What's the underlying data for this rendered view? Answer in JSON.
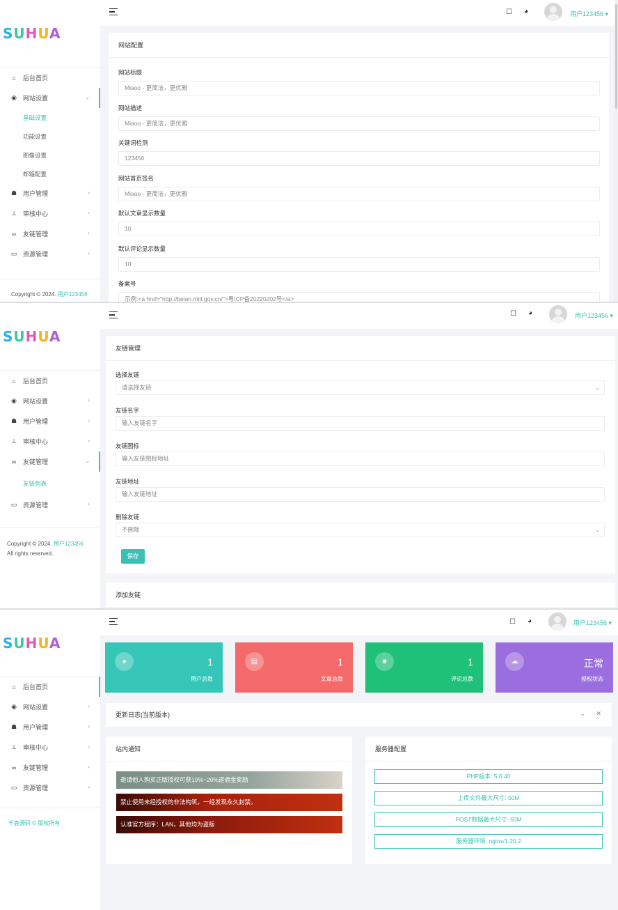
{
  "brand": {
    "logo_letters": [
      "S",
      "U",
      "H",
      "U",
      "A"
    ]
  },
  "user": {
    "name": "用户123456"
  },
  "sidebar": {
    "items": {
      "home": {
        "label": "后台首页",
        "icon": "home-icon"
      },
      "site": {
        "label": "网站设置",
        "icon": "globe-icon"
      },
      "users": {
        "label": "用户管理",
        "icon": "users-icon"
      },
      "audit": {
        "label": "审核中心",
        "icon": "stamp-icon"
      },
      "links": {
        "label": "友链管理",
        "icon": "link-icon"
      },
      "resources": {
        "label": "资源管理",
        "icon": "folder-icon"
      }
    },
    "site_subitems": [
      "基础设置",
      "功能设置",
      "图像设置",
      "邮箱配置"
    ],
    "links_subitems": [
      "友链列表"
    ]
  },
  "footer": {
    "copyright_prefix": "Copyright © 2024.",
    "rights": "All rights reserved.",
    "alt_text": "千鹿源码 © 版权所有"
  },
  "site_config": {
    "title": "网站配置",
    "fields": [
      {
        "label": "网站标题",
        "value": "Miaoo - 更简洁，更优雅"
      },
      {
        "label": "网站描述",
        "value": "Miaoo - 更简洁，更优雅"
      },
      {
        "label": "关键词检测",
        "value": "123456"
      },
      {
        "label": "网站首页签名",
        "value": "Miaoo - 更简洁，更优雅"
      },
      {
        "label": "默认文章显示数量",
        "value": "10"
      },
      {
        "label": "默认评论显示数量",
        "value": "10"
      },
      {
        "label": "备案号",
        "value": "示例:<a href=\"http://beian.miit.gov.cn/\">粤ICP备20220202号</a>"
      }
    ]
  },
  "link_manage": {
    "title": "友链管理",
    "fields": [
      {
        "label": "选择友链",
        "placeholder": "请选择友链",
        "select": true
      },
      {
        "label": "友链名字",
        "placeholder": "输入友链名字",
        "select": false
      },
      {
        "label": "友链图标",
        "placeholder": "输入友链图标地址",
        "select": false
      },
      {
        "label": "友链地址",
        "placeholder": "输入友链地址",
        "select": false
      },
      {
        "label": "删除友链",
        "placeholder": "不删除",
        "select": true
      }
    ],
    "save_label": "保存",
    "add_title": "添加友链"
  },
  "dashboard": {
    "stats": [
      {
        "value": "1",
        "label": "用户总数",
        "color": "#36c6b8",
        "icon": "user-icon",
        "glyph": "●"
      },
      {
        "value": "1",
        "label": "文章总数",
        "color": "#f46a6a",
        "icon": "article-icon",
        "glyph": "▤"
      },
      {
        "value": "1",
        "label": "评论总数",
        "color": "#1fc078",
        "icon": "comment-icon",
        "glyph": "■"
      },
      {
        "value": "正常",
        "label": "授权状态",
        "color": "#9b6ee0",
        "icon": "cloud-icon",
        "glyph": "☁"
      }
    ],
    "update_log_title": "更新日志(当前版本)",
    "notice_title": "站内通知",
    "notices": [
      {
        "text": "邀请他人购买正版授权可获10%~20%返佣金奖励",
        "color": "#7a8e84"
      },
      {
        "text": "禁止使用未经授权的非法构筑，一经发现永久封禁。",
        "color": "#a8200e"
      },
      {
        "text": "认准官方程序：LAN，其他均为盗版",
        "color": "#8a1a0c"
      }
    ],
    "server_title": "服务器配置",
    "server": [
      "PHP版本: 5.6.40",
      "上传文件最大尺寸: 50M",
      "POST数据最大尺寸: 50M",
      "服务器环境: nginx/1.20.2"
    ]
  },
  "colors": {
    "accent": "#39c2b4"
  }
}
